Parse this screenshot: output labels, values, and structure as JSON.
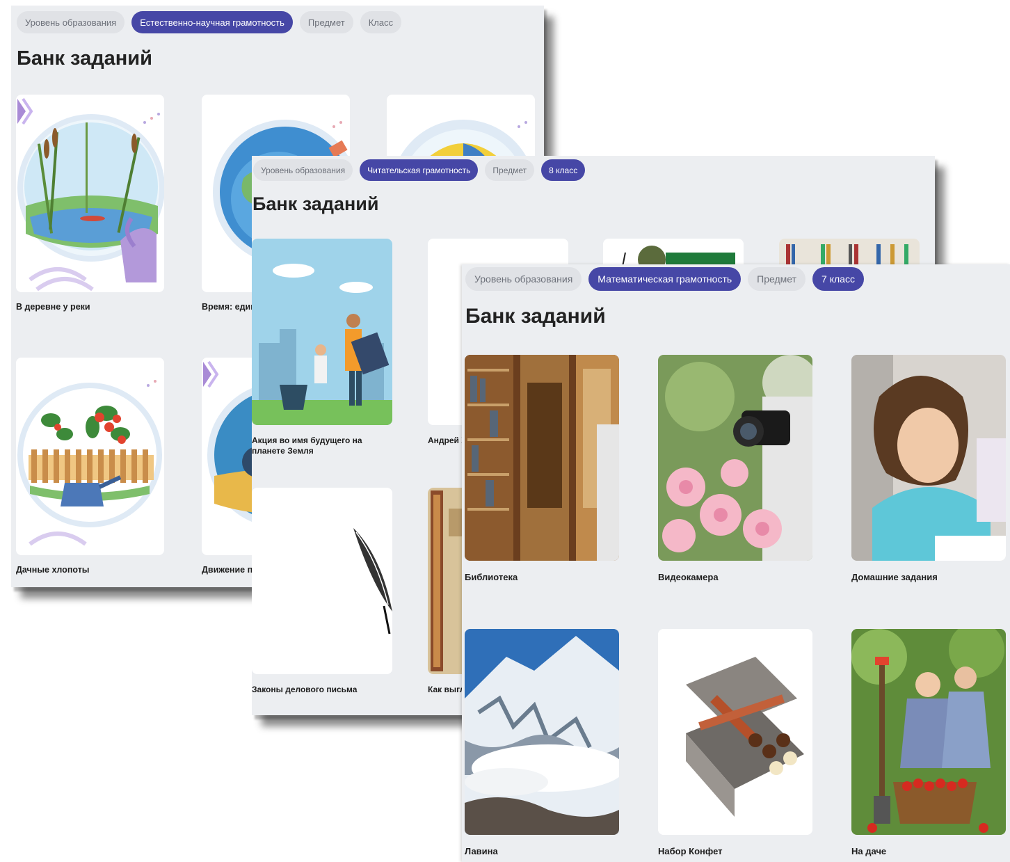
{
  "panel_1": {
    "filters": [
      "Уровень образования",
      "Естественно-научная грамотность",
      "Предмет",
      "Класс"
    ],
    "title": "Банк заданий",
    "cards": [
      "В деревне у реки",
      "Время: един",
      "",
      "Дачные хлопоты",
      "Движение п"
    ]
  },
  "panel_2": {
    "filters": [
      "Уровень образования",
      "Читательская грамотность",
      "Предмет",
      "8 класс"
    ],
    "title": "Банк заданий",
    "cards": [
      "Акция во имя будущего на планете Земля",
      "Андрей Х Пастерн",
      "",
      "",
      "Законы делового письма",
      "Как выгл"
    ]
  },
  "panel_3": {
    "filters": [
      "Уровень образования",
      "Математическая грамотность",
      "Предмет",
      "7 класс"
    ],
    "title": "Банк заданий",
    "cards": [
      "Библиотека",
      "Видеокамера",
      "Домашние задания",
      "Лавина",
      "Набор Конфет",
      "На даче"
    ]
  },
  "colors": {
    "accent": "#4647a6",
    "chip_inactive": "#e0e2e6",
    "panel_bg": "#eceef1"
  }
}
